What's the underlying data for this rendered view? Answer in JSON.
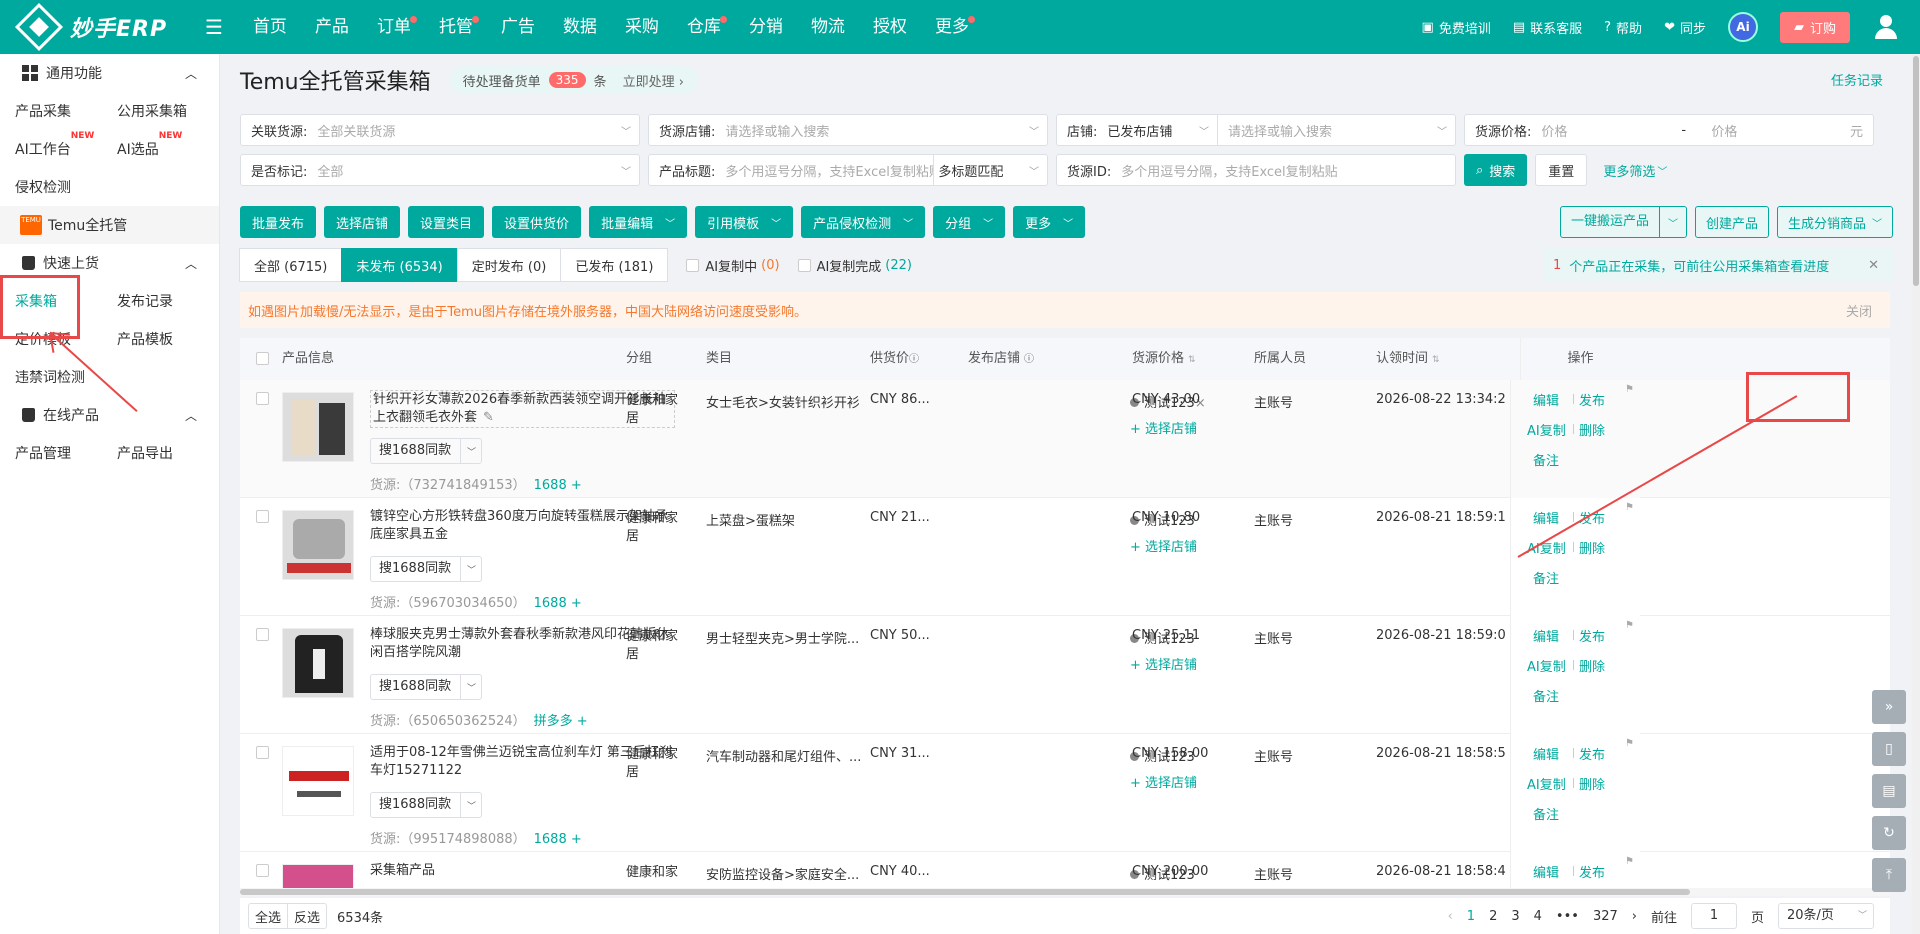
{
  "app": {
    "logo_text": "妙手ERP",
    "nav": [
      {
        "label": "首页",
        "dot": false
      },
      {
        "label": "产品",
        "dot": false
      },
      {
        "label": "订单",
        "dot": true
      },
      {
        "label": "托管",
        "dot": true
      },
      {
        "label": "广告",
        "dot": false
      },
      {
        "label": "数据",
        "dot": false
      },
      {
        "label": "采购",
        "dot": false
      },
      {
        "label": "仓库",
        "dot": true
      },
      {
        "label": "分销",
        "dot": false
      },
      {
        "label": "物流",
        "dot": false
      },
      {
        "label": "授权",
        "dot": false
      },
      {
        "label": "更多",
        "dot": true
      }
    ],
    "top_right": {
      "training": "免费培训",
      "support": "联系客服",
      "help": "帮助",
      "sync": "同步",
      "ai": "Ai",
      "order": "订购"
    }
  },
  "sidebar": {
    "groups": [
      {
        "label": "通用功能",
        "rows": [
          [
            "产品采集",
            "公用采集箱"
          ],
          [
            "AI工作台",
            "AI选品"
          ],
          [
            "侵权检测"
          ]
        ]
      },
      {
        "label": "Temu全托管"
      },
      {
        "label": "快速上货",
        "rows": [
          [
            "采集箱",
            "发布记录"
          ],
          [
            "定价模板",
            "产品模板"
          ],
          [
            "违禁词检测"
          ]
        ]
      },
      {
        "label": "在线产品",
        "rows": [
          [
            "产品管理",
            "产品导出"
          ]
        ]
      }
    ],
    "new_badge": "NEW",
    "temu_logo": "TEMU"
  },
  "page": {
    "title": "Temu全托管采集箱",
    "pending_label": "待处理备货单",
    "pending_count": "335",
    "pending_unit": "条",
    "pending_action": "立即处理 ›",
    "task_record": "任务记录"
  },
  "filters": {
    "source": {
      "label": "关联货源:",
      "value": "全部关联货源"
    },
    "source_store": {
      "label": "货源店铺:",
      "placeholder": "请选择或输入搜索"
    },
    "store": {
      "label": "店铺:",
      "value": "已发布店铺",
      "placeholder": "请选择或输入搜索"
    },
    "price": {
      "label": "货源价格:",
      "min": "价格",
      "dash": "-",
      "max": "价格",
      "unit": "元"
    },
    "marked": {
      "label": "是否标记:",
      "value": "全部"
    },
    "title": {
      "label": "产品标题:",
      "placeholder": "多个用逗号分隔，支持Excel复制粘贴",
      "match": "多标题匹配"
    },
    "source_id": {
      "label": "货源ID:",
      "placeholder": "多个用逗号分隔，支持Excel复制粘贴"
    },
    "search": "搜索",
    "reset": "重置",
    "more": "更多筛选"
  },
  "toolbar": {
    "left": [
      "批量发布",
      "选择店铺",
      "设置类目",
      "设置供货价"
    ],
    "dropdowns": [
      "批量编辑",
      "引用模板",
      "产品侵权检测",
      "分组",
      "更多"
    ],
    "right": {
      "move": "一键搬运产品",
      "create": "创建产品",
      "distribute": "生成分销商品"
    }
  },
  "tabs": [
    {
      "label": "全部 (6715)",
      "active": false
    },
    {
      "label": "未发布 (6534)",
      "active": true
    },
    {
      "label": "定时发布 (0)",
      "active": false
    },
    {
      "label": "已发布 (181)",
      "active": false
    }
  ],
  "ai_filters": {
    "copying_label": "AI复制中",
    "copying_count": "(0)",
    "done_label": "AI复制完成",
    "done_count": "(22)"
  },
  "collect_tip": {
    "num": "1",
    "text": "个产品正在采集，可前往公用采集箱查看进度"
  },
  "warning": {
    "text": "如遇图片加载慢/无法显示，是由于Temu图片存储在境外服务器，中国大陆网络访问速度受影响。",
    "close": "关闭"
  },
  "table": {
    "headers": {
      "info": "产品信息",
      "group": "分组",
      "category": "类目",
      "supply": "供货价",
      "store": "发布店铺",
      "price": "货源价格",
      "owner": "所属人员",
      "time": "认领时间",
      "ops": "操作"
    },
    "search_btn": "搜1688同款",
    "add_store": "选择店铺",
    "ops": {
      "edit": "编辑",
      "publish": "发布",
      "ai_copy": "AI复制",
      "delete": "删除",
      "note": "备注"
    },
    "rows": [
      {
        "name": "针织开衫女薄款2026春季新款西装领空调开衫长袖上衣翻领毛衣外套",
        "source": "货源:（732741849153）",
        "platform": "1688",
        "group": "健康和家",
        "group2": "居",
        "category": "女士毛衣>女装针织衫开衫",
        "supply": "CNY 86...",
        "store": "测试123",
        "store_x": "×",
        "price": "CNY 43.00",
        "owner": "主账号",
        "time": "2026-08-22 13:34:2",
        "thumb": "sweater"
      },
      {
        "name": "镀锌空心方形铁转盘360度万向旋转蛋糕展示架轴承底座家具五金",
        "source": "货源:（596703034650）",
        "platform": "1688",
        "group": "健康和家",
        "group2": "居",
        "category": "上菜盘>蛋糕架",
        "supply": "CNY 21...",
        "store": "测试123",
        "store_x": "",
        "price": "CNY 10.80",
        "owner": "主账号",
        "time": "2026-08-21 18:59:1",
        "thumb": "metal"
      },
      {
        "name": "棒球服夹克男士薄款外套春秋季新款港风印花韩版休闲百搭学院风潮",
        "source": "货源:（650650362524）",
        "platform": "拼多多",
        "group": "健康和家",
        "group2": "居",
        "category": "男士轻型夹克>男士学院...",
        "supply": "CNY 50...",
        "store": "测试123",
        "store_x": "",
        "price": "CNY 25.11",
        "owner": "主账号",
        "time": "2026-08-21 18:59:0",
        "thumb": "jacket"
      },
      {
        "name": "适用于08-12年雪佛兰迈锐宝高位刹车灯 第三后杠刹车灯15271122",
        "source": "货源:（995174898088）",
        "platform": "1688",
        "group": "健康和家",
        "group2": "居",
        "category": "汽车制动器和尾灯组件、...",
        "supply": "CNY 31...",
        "store": "测试123",
        "store_x": "",
        "price": "CNY 158.00",
        "owner": "主账号",
        "time": "2026-08-21 18:58:5",
        "thumb": "lamp"
      },
      {
        "name": "采集箱产品",
        "source": "",
        "platform": "",
        "group": "健康和家",
        "group2": "",
        "category": "安防监控设备>家庭安全...",
        "supply": "CNY 40...",
        "store": "测试123",
        "store_x": "",
        "price": "CNY 200.00",
        "owner": "主账号",
        "time": "2026-08-21 18:58:4",
        "thumb": "pink"
      }
    ]
  },
  "footer": {
    "select_all": "全选",
    "invert": "反选",
    "count": "6534条",
    "pages": [
      "1",
      "2",
      "3",
      "4",
      "•••",
      "327"
    ],
    "goto": "前往",
    "goto_val": "1",
    "page_unit": "页",
    "per_page": "20条/页"
  },
  "colors": {
    "primary": "#00a99e",
    "danger": "#e84848",
    "warn": "#f5782c"
  }
}
